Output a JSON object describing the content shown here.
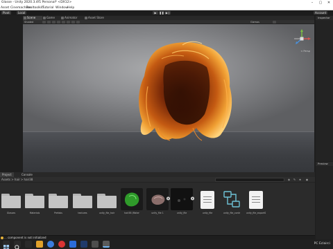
{
  "window": {
    "title": "Glasse - Unity 2020.3.4f1 Personal* <DX12>"
  },
  "menu": [
    "Asset",
    "Cinemachine",
    "Realtoolkit",
    "Tutorial",
    "Window",
    "Help"
  ],
  "toolbar": {
    "left_label": "Pivot",
    "right_label": "Local",
    "layers_label": "Account"
  },
  "tabs": [
    {
      "label": "Scene",
      "active": true
    },
    {
      "label": "Game",
      "active": false
    },
    {
      "label": "Animator",
      "active": false
    },
    {
      "label": "Asset Store",
      "active": false
    }
  ],
  "scene_tools": {
    "shaded_label": "Shaded",
    "gizmos_label": "Gizmos"
  },
  "gizmo": {
    "persp_label": "< Persp"
  },
  "right_panel": {
    "inspector_label": "Inspector",
    "preview_label": "Preview"
  },
  "project": {
    "tabs": [
      {
        "label": "Project",
        "active": true
      },
      {
        "label": "Console",
        "active": false
      }
    ],
    "breadcrumb": "Assets > hair > hair38"
  },
  "assets": [
    {
      "name": "Glasses",
      "kind": "folder"
    },
    {
      "name": "Materials",
      "kind": "folder"
    },
    {
      "name": "Prefabs",
      "kind": "folder"
    },
    {
      "name": "textures",
      "kind": "folder"
    },
    {
      "name": "unity_file_hair",
      "kind": "folder"
    },
    {
      "name": "hair38 (Mater",
      "kind": "material_green"
    },
    {
      "name": "unity_file 1",
      "kind": "mesh"
    },
    {
      "name": "unity_file",
      "kind": "mesh_dark"
    },
    {
      "name": "unity_file",
      "kind": "doc"
    },
    {
      "name": "unity_file_contr",
      "kind": "diagram"
    },
    {
      "name": "unity_file_exportS",
      "kind": "doc"
    }
  ],
  "status": {
    "message": "... component is not initialized"
  },
  "taskbar": {
    "locale": "ENG",
    "label": "PC  Eclairci",
    "time": ""
  },
  "colors": {
    "accent": "#4a8fd8",
    "hair_glow": "#e8a030",
    "scene_bg": "#8f9093"
  }
}
